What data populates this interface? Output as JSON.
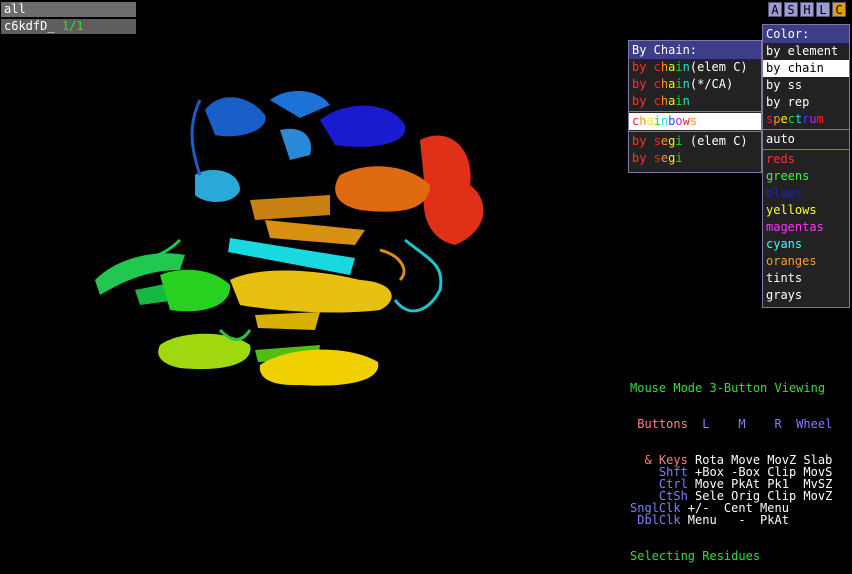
{
  "object_panel": {
    "all_label": "all",
    "object_name": "c6kdfD_",
    "object_state": "1/1",
    "action_buttons": [
      "A",
      "S",
      "H",
      "L",
      "C"
    ]
  },
  "color_menu": {
    "title": "Color:",
    "items_top": [
      "by element",
      "by chain",
      "by ss",
      "by rep",
      "spectrum"
    ],
    "item_auto": "auto",
    "colors": [
      {
        "label": "reds",
        "color": "#ff3030"
      },
      {
        "label": "greens",
        "color": "#30ff30"
      },
      {
        "label": "blues",
        "color": "#3030ff"
      },
      {
        "label": "yellows",
        "color": "#ffff30"
      },
      {
        "label": "magentas",
        "color": "#ff30ff"
      },
      {
        "label": "cyans",
        "color": "#30ffff"
      },
      {
        "label": "oranges",
        "color": "#ff9a30"
      },
      {
        "label": "tints",
        "color": "#ffffff"
      },
      {
        "label": "grays",
        "color": "#ffffff"
      }
    ],
    "selected": "by chain"
  },
  "chain_menu": {
    "title": "By Chain:",
    "items": [
      {
        "prefix": "by ",
        "word": "chain",
        "suffix": "(elem C)"
      },
      {
        "prefix": "by ",
        "word": "chain",
        "suffix": "(*/CA)"
      },
      {
        "prefix": "by ",
        "word": "chain",
        "suffix": ""
      },
      {
        "prefix": "",
        "word": "chainbows",
        "suffix": ""
      },
      {
        "prefix": "by ",
        "word": "segi",
        "suffix": " (elem C)"
      },
      {
        "prefix": "by ",
        "word": "segi",
        "suffix": ""
      }
    ],
    "selected": "chainbows"
  },
  "mouse_panel": {
    "line1": "Mouse Mode 3-Button Viewing",
    "header_left": " Buttons",
    "header_cols": "  L    M    R  Wheel",
    "rows": [
      {
        "k": "  & Keys",
        "v": " Rota Move MovZ Slab"
      },
      {
        "k": "    Shft",
        "v": " +Box -Box Clip MovS"
      },
      {
        "k": "    Ctrl",
        "v": " Move PkAt Pk1  MvSZ"
      },
      {
        "k": "    CtSh",
        "v": " Sele Orig Clip MovZ"
      },
      {
        "k": "SnglClk",
        "v": " +/-  Cent Menu"
      },
      {
        "k": " DblClk",
        "v": " Menu   -  PkAt"
      }
    ],
    "footer": "Selecting Residues"
  }
}
